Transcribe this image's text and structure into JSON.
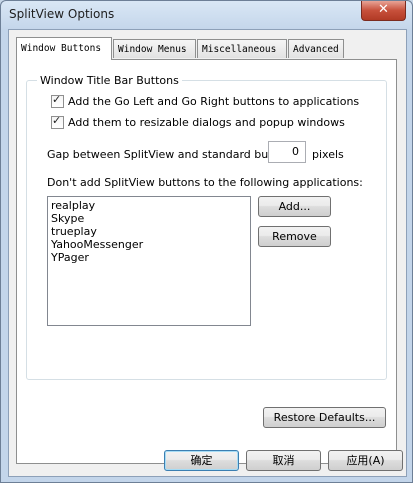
{
  "window": {
    "title": "SplitView Options",
    "close_glyph": "✕"
  },
  "tabs": [
    {
      "label": "Window Buttons",
      "active": true
    },
    {
      "label": "Window Menus",
      "active": false
    },
    {
      "label": "Miscellaneous",
      "active": false
    },
    {
      "label": "Advanced",
      "active": false
    }
  ],
  "group": {
    "title": "Window Title Bar Buttons",
    "checkboxes": [
      {
        "label": "Add the Go Left and Go Right buttons to applications",
        "checked": true
      },
      {
        "label": "Add them to resizable dialogs and popup windows",
        "checked": true
      }
    ],
    "gap_label": "Gap between SplitView and standard buttons:",
    "gap_value": "0",
    "gap_unit": "pixels",
    "exclude_label": "Don't add SplitView buttons to the following applications:",
    "apps": [
      "realplay",
      "Skype",
      "trueplay",
      "YahooMessenger",
      "YPager"
    ],
    "add_label": "Add...",
    "remove_label": "Remove"
  },
  "restore_label": "Restore Defaults...",
  "footer": {
    "ok_label": "确定",
    "cancel_label": "取消",
    "apply_label": "应用(A)"
  }
}
